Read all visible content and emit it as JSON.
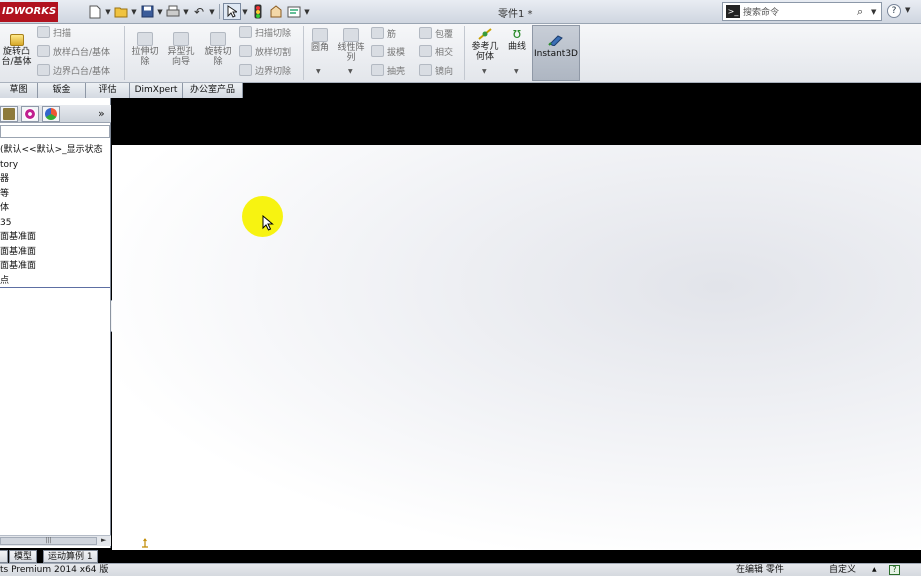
{
  "window": {
    "logo_text": "IDWORKS",
    "doc_title": "零件1 *",
    "search_placeholder": "搜索命令",
    "help_glyph": "?"
  },
  "ribbon": {
    "revolve": "旋转凸\n台/基体",
    "sweep": "扫描",
    "loft": "放样凸台/基体",
    "boundary": "边界凸台/基体",
    "extrude_cut": "拉伸切\n除",
    "hole_wizard": "异型孔\n向导",
    "revolve_cut": "旋转切\n除",
    "swept_cut": "扫描切除",
    "lofted_cut": "放样切割",
    "boundary_cut": "边界切除",
    "fillet": "圆角",
    "linear_pattern": "线性阵\n列",
    "rib": "筋",
    "draft": "拔模",
    "shell": "抽壳",
    "wrap": "包覆",
    "intersect": "相交",
    "mirror": "镜向",
    "ref_geometry": "参考几\n何体",
    "curves": "曲线",
    "instant3d": "Instant3D"
  },
  "tabs": [
    "草图",
    "钣金",
    "评估",
    "DimXpert",
    "办公室产品"
  ],
  "tree": {
    "items": [
      "(默认<<默认>_显示状态",
      "tory",
      "器",
      "等",
      "体",
      "35",
      "面基准面",
      "面基准面",
      "面基准面",
      "点"
    ],
    "more_glyph": "»"
  },
  "bottom_tabs": [
    "模型",
    "运动算例 1"
  ],
  "status": {
    "product": "ts Premium 2014 x64 版",
    "editing": "在编辑 零件",
    "custom": "自定义",
    "help_glyph": "?"
  }
}
